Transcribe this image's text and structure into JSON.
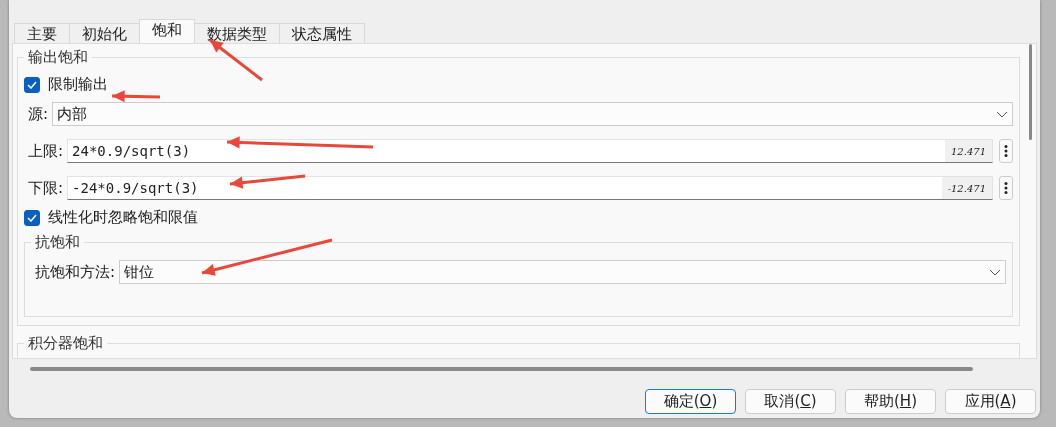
{
  "tabs": [
    {
      "label": "主要",
      "selected": false
    },
    {
      "label": "初始化",
      "selected": false
    },
    {
      "label": "饱和",
      "selected": true
    },
    {
      "label": "数据类型",
      "selected": false
    },
    {
      "label": "状态属性",
      "selected": false
    }
  ],
  "output_saturation": {
    "title": "输出饱和",
    "limit_output": {
      "label": "限制输出",
      "checked": true
    },
    "source": {
      "label": "源:",
      "value": "内部"
    },
    "upper": {
      "label": "上限:",
      "value": "24*0.9/sqrt(3)",
      "result": "12.471"
    },
    "lower": {
      "label": "下限:",
      "value": "-24*0.9/sqrt(3)",
      "result": "-12.471"
    },
    "ignore_linearization": {
      "label": "线性化时忽略饱和限值",
      "checked": true
    },
    "anti_windup": {
      "title": "抗饱和",
      "method": {
        "label": "抗饱和方法:",
        "value": "钳位"
      }
    }
  },
  "integrator_saturation": {
    "title": "积分器饱和"
  },
  "buttons": [
    {
      "pre": "确定(",
      "key": "O",
      "post": ")",
      "selected": true
    },
    {
      "pre": "取消(",
      "key": "C",
      "post": ")",
      "selected": false
    },
    {
      "pre": "帮助(",
      "key": "H",
      "post": ")",
      "selected": false
    },
    {
      "pre": "应用(",
      "key": "A",
      "post": ")",
      "selected": false
    }
  ]
}
